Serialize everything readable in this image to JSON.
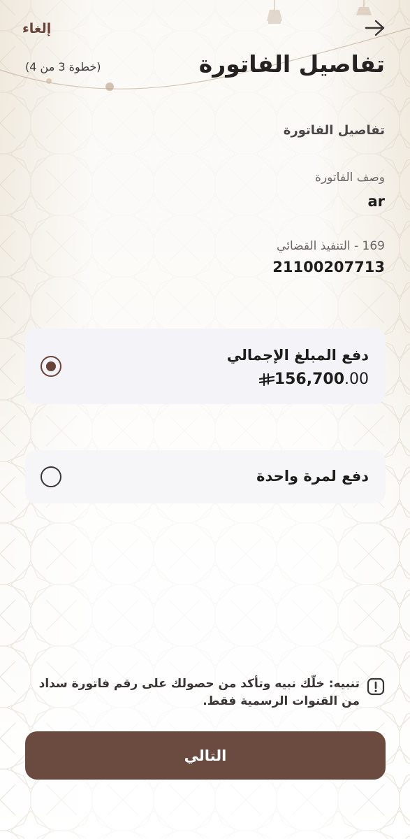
{
  "header": {
    "back_icon": "arrow-right-icon",
    "cancel_label": "إلغاء",
    "title": "تفاصيل الفاتورة",
    "step": "(خطوة 3 من 4)"
  },
  "bill": {
    "section_title": "تفاصيل الفاتورة",
    "description_label": "وصف الفاتورة",
    "description_value": "ar",
    "service_label": "169 - التنفيذ القضائي",
    "service_value": "21100207713"
  },
  "options": [
    {
      "title": "دفع المبلغ الإجمالي",
      "amount_main": "156,700",
      "amount_decimals": ".00",
      "currency_icon": "saudi-riyal-icon",
      "selected": true
    },
    {
      "title": "دفع لمرة واحدة",
      "selected": false
    }
  ],
  "notice": {
    "icon": "exclamation-icon",
    "text": "تنبيه: خلّك نبيه وتأكد من حصولك على رقم فاتورة سداد من القنوات الرسمية فقط."
  },
  "footer": {
    "next_label": "التالي"
  },
  "colors": {
    "brand_brown": "#6b4a40",
    "accent_text": "#6a4338",
    "header_bg": "#f2ece1",
    "card_bg": "#f6f6f9"
  }
}
